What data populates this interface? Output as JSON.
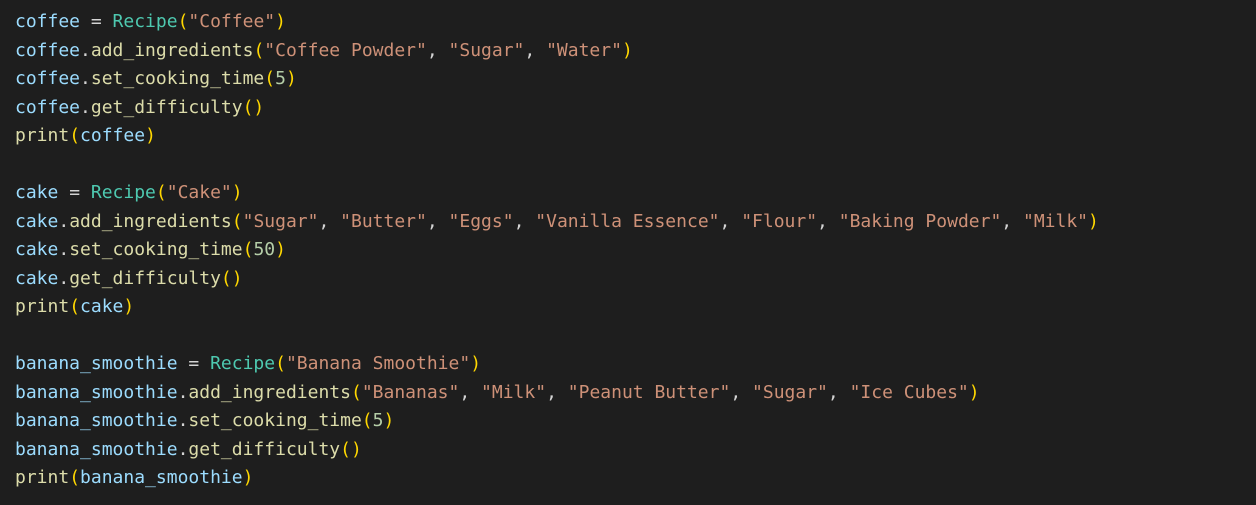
{
  "editor": {
    "language": "python",
    "colors": {
      "background": "#1e1e1e",
      "default": "#d4d4d4",
      "variable": "#9cdcfe",
      "function": "#dcdcaa",
      "class": "#4ec9b0",
      "string": "#ce9178",
      "number": "#b5cea8",
      "bracket": "#ffd700"
    },
    "lines": [
      {
        "tokens": [
          {
            "t": "coffee",
            "k": "var"
          },
          {
            "t": " = ",
            "k": "op"
          },
          {
            "t": "Recipe",
            "k": "class"
          },
          {
            "t": "(",
            "k": "paren"
          },
          {
            "t": "\"Coffee\"",
            "k": "str"
          },
          {
            "t": ")",
            "k": "paren"
          }
        ]
      },
      {
        "tokens": [
          {
            "t": "coffee",
            "k": "var"
          },
          {
            "t": ".",
            "k": "op"
          },
          {
            "t": "add_ingredients",
            "k": "fn"
          },
          {
            "t": "(",
            "k": "paren"
          },
          {
            "t": "\"Coffee Powder\"",
            "k": "str"
          },
          {
            "t": ", ",
            "k": "op"
          },
          {
            "t": "\"Sugar\"",
            "k": "str"
          },
          {
            "t": ", ",
            "k": "op"
          },
          {
            "t": "\"Water\"",
            "k": "str"
          },
          {
            "t": ")",
            "k": "paren"
          }
        ]
      },
      {
        "tokens": [
          {
            "t": "coffee",
            "k": "var"
          },
          {
            "t": ".",
            "k": "op"
          },
          {
            "t": "set_cooking_time",
            "k": "fn"
          },
          {
            "t": "(",
            "k": "paren"
          },
          {
            "t": "5",
            "k": "num"
          },
          {
            "t": ")",
            "k": "paren"
          }
        ]
      },
      {
        "tokens": [
          {
            "t": "coffee",
            "k": "var"
          },
          {
            "t": ".",
            "k": "op"
          },
          {
            "t": "get_difficulty",
            "k": "fn"
          },
          {
            "t": "()",
            "k": "paren"
          }
        ]
      },
      {
        "tokens": [
          {
            "t": "print",
            "k": "fn"
          },
          {
            "t": "(",
            "k": "paren"
          },
          {
            "t": "coffee",
            "k": "var"
          },
          {
            "t": ")",
            "k": "paren"
          }
        ]
      },
      {
        "tokens": []
      },
      {
        "tokens": [
          {
            "t": "cake",
            "k": "var"
          },
          {
            "t": " = ",
            "k": "op"
          },
          {
            "t": "Recipe",
            "k": "class"
          },
          {
            "t": "(",
            "k": "paren"
          },
          {
            "t": "\"Cake\"",
            "k": "str"
          },
          {
            "t": ")",
            "k": "paren"
          }
        ]
      },
      {
        "tokens": [
          {
            "t": "cake",
            "k": "var"
          },
          {
            "t": ".",
            "k": "op"
          },
          {
            "t": "add_ingredients",
            "k": "fn"
          },
          {
            "t": "(",
            "k": "paren"
          },
          {
            "t": "\"Sugar\"",
            "k": "str"
          },
          {
            "t": ", ",
            "k": "op"
          },
          {
            "t": "\"Butter\"",
            "k": "str"
          },
          {
            "t": ", ",
            "k": "op"
          },
          {
            "t": "\"Eggs\"",
            "k": "str"
          },
          {
            "t": ", ",
            "k": "op"
          },
          {
            "t": "\"Vanilla Essence\"",
            "k": "str"
          },
          {
            "t": ", ",
            "k": "op"
          },
          {
            "t": "\"Flour\"",
            "k": "str"
          },
          {
            "t": ", ",
            "k": "op"
          },
          {
            "t": "\"Baking Powder\"",
            "k": "str"
          },
          {
            "t": ", ",
            "k": "op"
          },
          {
            "t": "\"Milk\"",
            "k": "str"
          },
          {
            "t": ")",
            "k": "paren"
          }
        ]
      },
      {
        "tokens": [
          {
            "t": "cake",
            "k": "var"
          },
          {
            "t": ".",
            "k": "op"
          },
          {
            "t": "set_cooking_time",
            "k": "fn"
          },
          {
            "t": "(",
            "k": "paren"
          },
          {
            "t": "50",
            "k": "num"
          },
          {
            "t": ")",
            "k": "paren"
          }
        ]
      },
      {
        "tokens": [
          {
            "t": "cake",
            "k": "var"
          },
          {
            "t": ".",
            "k": "op"
          },
          {
            "t": "get_difficulty",
            "k": "fn"
          },
          {
            "t": "()",
            "k": "paren"
          }
        ]
      },
      {
        "tokens": [
          {
            "t": "print",
            "k": "fn"
          },
          {
            "t": "(",
            "k": "paren"
          },
          {
            "t": "cake",
            "k": "var"
          },
          {
            "t": ")",
            "k": "paren"
          }
        ]
      },
      {
        "tokens": []
      },
      {
        "tokens": [
          {
            "t": "banana_smoothie",
            "k": "var"
          },
          {
            "t": " = ",
            "k": "op"
          },
          {
            "t": "Recipe",
            "k": "class"
          },
          {
            "t": "(",
            "k": "paren"
          },
          {
            "t": "\"Banana Smoothie\"",
            "k": "str"
          },
          {
            "t": ")",
            "k": "paren"
          }
        ]
      },
      {
        "tokens": [
          {
            "t": "banana_smoothie",
            "k": "var"
          },
          {
            "t": ".",
            "k": "op"
          },
          {
            "t": "add_ingredients",
            "k": "fn"
          },
          {
            "t": "(",
            "k": "paren"
          },
          {
            "t": "\"Bananas\"",
            "k": "str"
          },
          {
            "t": ", ",
            "k": "op"
          },
          {
            "t": "\"Milk\"",
            "k": "str"
          },
          {
            "t": ", ",
            "k": "op"
          },
          {
            "t": "\"Peanut Butter\"",
            "k": "str"
          },
          {
            "t": ", ",
            "k": "op"
          },
          {
            "t": "\"Sugar\"",
            "k": "str"
          },
          {
            "t": ", ",
            "k": "op"
          },
          {
            "t": "\"Ice Cubes\"",
            "k": "str"
          },
          {
            "t": ")",
            "k": "paren"
          }
        ]
      },
      {
        "tokens": [
          {
            "t": "banana_smoothie",
            "k": "var"
          },
          {
            "t": ".",
            "k": "op"
          },
          {
            "t": "set_cooking_time",
            "k": "fn"
          },
          {
            "t": "(",
            "k": "paren"
          },
          {
            "t": "5",
            "k": "num"
          },
          {
            "t": ")",
            "k": "paren"
          }
        ]
      },
      {
        "tokens": [
          {
            "t": "banana_smoothie",
            "k": "var"
          },
          {
            "t": ".",
            "k": "op"
          },
          {
            "t": "get_difficulty",
            "k": "fn"
          },
          {
            "t": "()",
            "k": "paren"
          }
        ]
      },
      {
        "tokens": [
          {
            "t": "print",
            "k": "fn"
          },
          {
            "t": "(",
            "k": "paren"
          },
          {
            "t": "banana_smoothie",
            "k": "var"
          },
          {
            "t": ")",
            "k": "paren"
          }
        ]
      }
    ]
  }
}
